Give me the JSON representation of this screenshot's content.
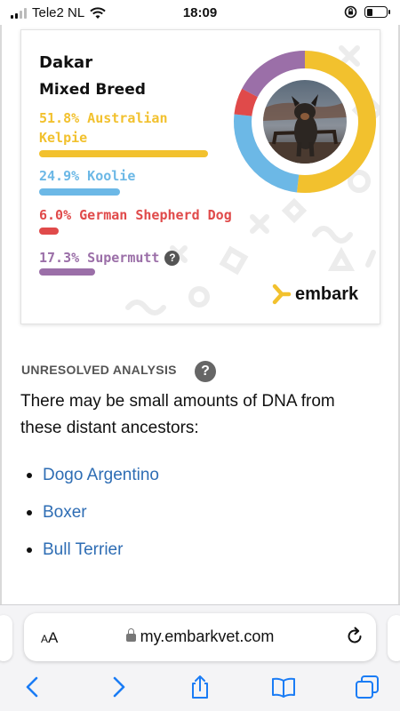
{
  "status_bar": {
    "carrier": "Tele2 NL",
    "time": "18:09",
    "battery_level": 0.3
  },
  "card": {
    "dog_name": "Dakar",
    "breed_type": "Mixed Breed",
    "breeds": [
      {
        "label_line1": "51.8% Australian",
        "label_line2": "Kelpie",
        "percent": 51.8,
        "color": "#f2c12e"
      },
      {
        "label_line1": "24.9% Koolie",
        "percent": 24.9,
        "color": "#6cb8e6"
      },
      {
        "label_line1": "6.0% German Shepherd Dog",
        "percent": 6.0,
        "color": "#e04a4a"
      },
      {
        "label_line1": "17.3% Supermutt",
        "percent": 17.3,
        "color": "#9b6fa8"
      }
    ],
    "help_glyph": "?",
    "logo_text": "embark",
    "logo_icon": "embark-logo-icon"
  },
  "unresolved": {
    "title": "UNRESOLVED ANALYSIS",
    "help_glyph": "?",
    "description": "There may be small amounts of DNA from these distant ancestors:",
    "ancestors": [
      "Dogo Argentino",
      "Boxer",
      "Bull Terrier"
    ]
  },
  "browser": {
    "text_size_label_small": "A",
    "text_size_label_large": "A",
    "url": "my.embarkvet.com",
    "toolbar_icons": [
      "back-icon",
      "forward-icon",
      "share-icon",
      "bookmarks-icon",
      "tabs-icon"
    ]
  },
  "colors": {
    "link": "#2e6db4",
    "yellow": "#f2c12e",
    "blue": "#6cb8e6",
    "red": "#e04a4a",
    "purple": "#9b6fa8",
    "ios_blue": "#1a7cf5"
  }
}
